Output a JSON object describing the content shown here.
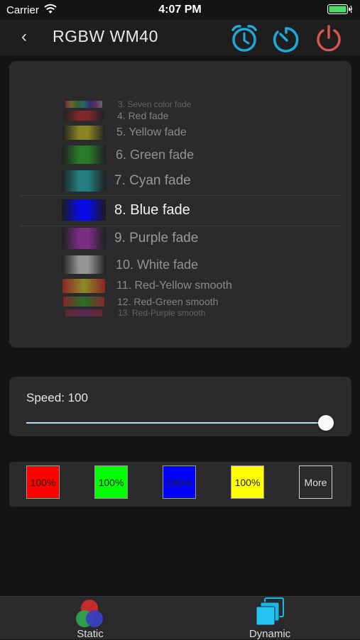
{
  "status": {
    "carrier": "Carrier",
    "time": "4:07 PM"
  },
  "nav": {
    "back_glyph": "‹",
    "title": "RGBW WM40"
  },
  "colors": {
    "accent": "#1fa9d8",
    "power": "#d9534f",
    "card": "#2b2b2d",
    "bg": "#141414"
  },
  "modes": [
    {
      "label": "3. Seven color fade"
    },
    {
      "label": "4. Red fade"
    },
    {
      "label": "5. Yellow fade"
    },
    {
      "label": "6. Green fade"
    },
    {
      "label": "7. Cyan fade"
    },
    {
      "label": "8. Blue fade"
    },
    {
      "label": "9. Purple fade"
    },
    {
      "label": "10. White fade"
    },
    {
      "label": "11. Red-Yellow smooth"
    },
    {
      "label": "12. Red-Green smooth"
    },
    {
      "label": "13. Red-Purple smooth"
    }
  ],
  "selected_mode": "8. Blue fade",
  "speed": {
    "label": "Speed: 100",
    "value": 100,
    "max": 100
  },
  "presets": [
    {
      "label": "100%",
      "color": "#ff0000"
    },
    {
      "label": "100%",
      "color": "#00ff00"
    },
    {
      "label": "100%",
      "color": "#0000ff"
    },
    {
      "label": "100%",
      "color": "#ffff00"
    }
  ],
  "more_label": "More",
  "tabs": [
    {
      "label": "Static",
      "icon": "rgb-circles-icon"
    },
    {
      "label": "Dynamic",
      "icon": "stacked-squares-icon"
    }
  ]
}
